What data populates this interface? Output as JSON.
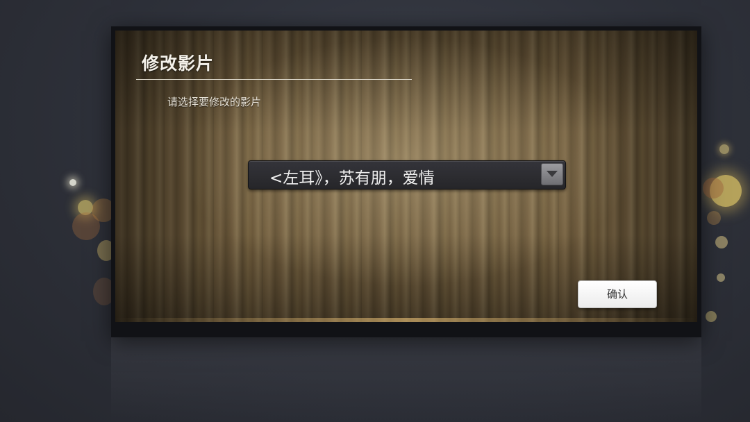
{
  "dialog": {
    "title": "修改影片",
    "subtitle": "请选择要修改的影片",
    "select": {
      "value": "<左耳》，苏有朋，爱情",
      "dropdown_icon": "triangle-down-icon"
    },
    "confirm_label": "确认"
  },
  "colors": {
    "background": "#2f323b",
    "frame": "#111216",
    "wood": "#6b5839",
    "select_bg": "#2b2b2f",
    "button_bg": "#f4f4f4",
    "text_light": "#f4f1ea"
  }
}
